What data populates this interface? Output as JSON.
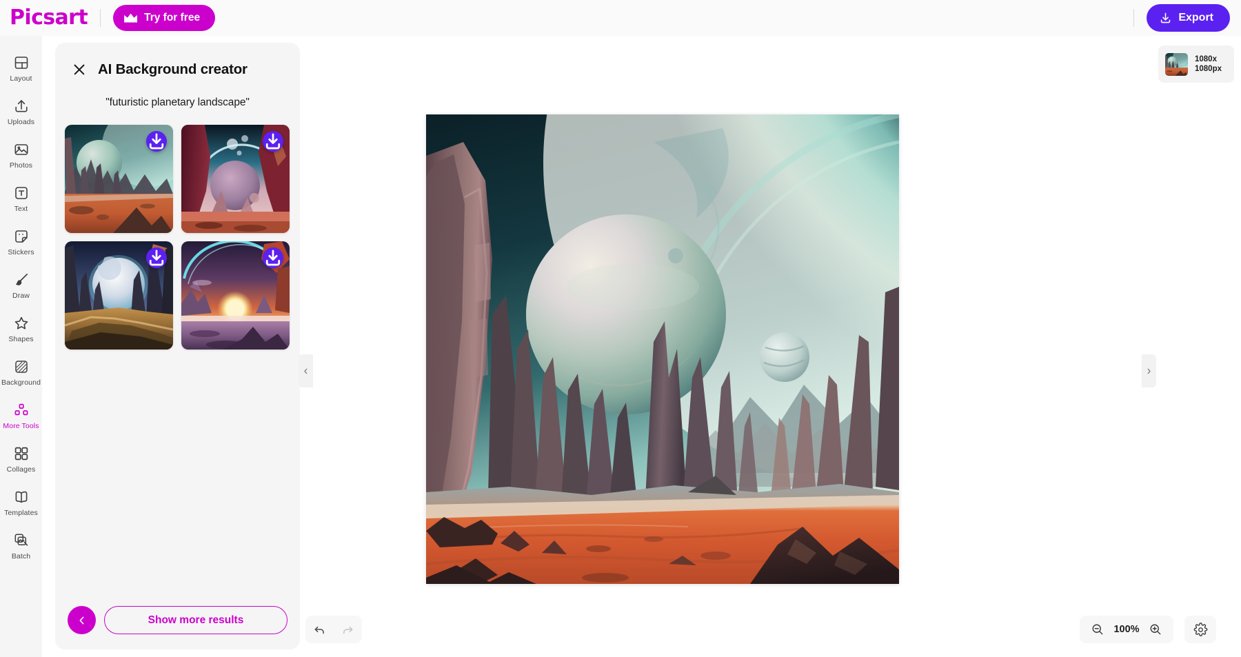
{
  "app": {
    "brand": "Picsart",
    "try_free_label": "Try for free",
    "export_label": "Export"
  },
  "sidebar": {
    "items": [
      {
        "label": "Layout",
        "icon": "layout-icon",
        "active": false
      },
      {
        "label": "Uploads",
        "icon": "upload-icon",
        "active": false
      },
      {
        "label": "Photos",
        "icon": "photos-icon",
        "active": false
      },
      {
        "label": "Text",
        "icon": "text-icon",
        "active": false
      },
      {
        "label": "Stickers",
        "icon": "sticker-icon",
        "active": false
      },
      {
        "label": "Draw",
        "icon": "brush-icon",
        "active": false
      },
      {
        "label": "Shapes",
        "icon": "star-icon",
        "active": false
      },
      {
        "label": "Background",
        "icon": "background-icon",
        "active": false
      },
      {
        "label": "More Tools",
        "icon": "more-tools-icon",
        "active": true
      },
      {
        "label": "Collages",
        "icon": "collages-icon",
        "active": false
      },
      {
        "label": "Templates",
        "icon": "templates-icon",
        "active": false
      },
      {
        "label": "Batch",
        "icon": "batch-icon",
        "active": false
      }
    ]
  },
  "panel": {
    "title": "AI Background creator",
    "close_icon": "close-icon",
    "prompt": "\"futuristic planetary landscape\"",
    "results": [
      {
        "id": 1,
        "alt": "teal sky canyon with ringed planet over red desert",
        "download_label": "download-icon"
      },
      {
        "id": 2,
        "alt": "crimson cliff with pale purple planet and moons",
        "download_label": "download-icon"
      },
      {
        "id": 3,
        "alt": "blue spires valley with glowing white planet",
        "download_label": "download-icon"
      },
      {
        "id": 4,
        "alt": "violet sunset over purple dunes with arc",
        "download_label": "download-icon"
      }
    ],
    "back_label": "chevron-left-icon",
    "show_more_label": "Show more results"
  },
  "canvas": {
    "image_alt": "futuristic planetary landscape with teal ringed sky, rock spires and orange desert",
    "collapse_left_icon": "chevron-left-icon",
    "collapse_right_icon": "chevron-right-icon"
  },
  "layers": {
    "items": [
      {
        "size_line1": "1080x",
        "size_line2": "1080px",
        "alt": "project thumbnail"
      }
    ]
  },
  "bottom": {
    "undo_label": "undo-icon",
    "redo_label": "redo-icon",
    "zoom_out_label": "zoom-out-icon",
    "zoom_level": "100%",
    "zoom_in_label": "zoom-in-icon",
    "settings_label": "gear-icon"
  },
  "colors": {
    "brand_magenta": "#cc00cc",
    "accent_purple": "#5b21f0",
    "panel_bg": "#f5f5f5",
    "rail_bg": "#f5f5f5",
    "text_dark": "#1a1a1a"
  }
}
